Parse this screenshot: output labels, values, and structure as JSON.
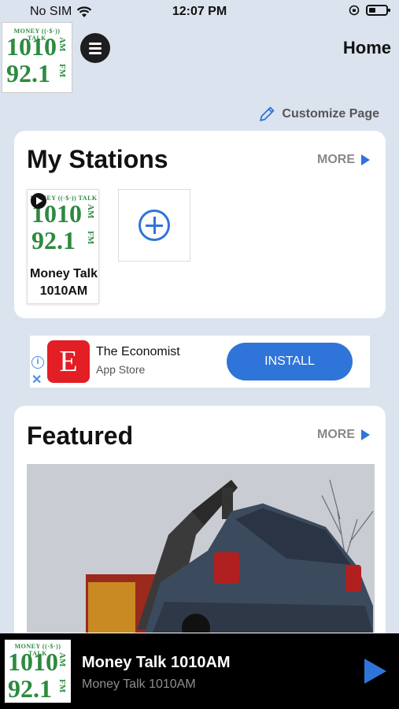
{
  "status_bar": {
    "carrier": "No SIM",
    "time": "12:07 PM"
  },
  "header": {
    "title": "Home"
  },
  "logo": {
    "top_text": "MONEY ((·$·)) TALK",
    "line1": "1010",
    "line2": "92.1",
    "band1": "AM",
    "band2": "FM"
  },
  "customize": {
    "label": "Customize Page"
  },
  "my_stations": {
    "title": "My Stations",
    "more_label": "MORE",
    "stations": [
      {
        "name": "Money Talk 1010AM"
      }
    ]
  },
  "ad": {
    "brand_letter": "E",
    "title": "The Economist",
    "subtitle": "App Store",
    "button_label": "INSTALL",
    "info_glyph": "i",
    "close_glyph": "✕"
  },
  "featured": {
    "title": "Featured",
    "more_label": "MORE"
  },
  "player": {
    "title": "Money Talk 1010AM",
    "subtitle": "Money Talk 1010AM"
  },
  "colors": {
    "accent": "#2f74d8",
    "background": "#dbe3ee",
    "logo_green": "#2c8a3f",
    "ad_red": "#e31e24"
  }
}
